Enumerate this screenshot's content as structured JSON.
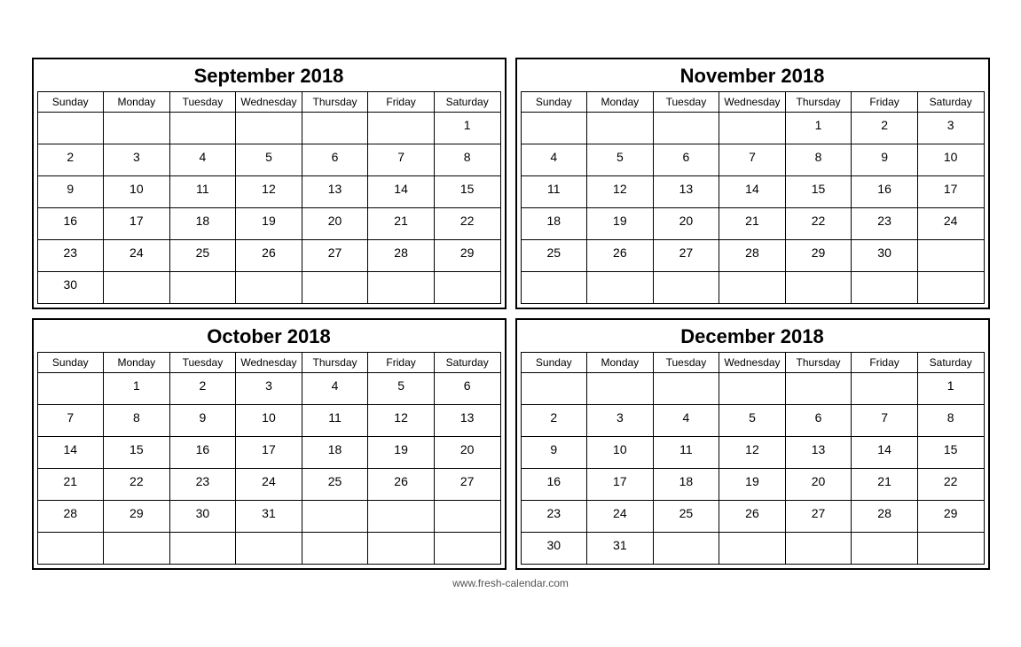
{
  "footer": {
    "url": "www.fresh-calendar.com"
  },
  "calendars": [
    {
      "id": "sep2018",
      "title": "September 2018",
      "days": [
        "Sunday",
        "Monday",
        "Tuesday",
        "Wednesday",
        "Thursday",
        "Friday",
        "Saturday"
      ],
      "weeks": [
        [
          "",
          "",
          "",
          "",
          "",
          "",
          "1"
        ],
        [
          "2",
          "3",
          "4",
          "5",
          "6",
          "7",
          "8"
        ],
        [
          "9",
          "10",
          "11",
          "12",
          "13",
          "14",
          "15"
        ],
        [
          "16",
          "17",
          "18",
          "19",
          "20",
          "21",
          "22"
        ],
        [
          "23",
          "24",
          "25",
          "26",
          "27",
          "28",
          "29"
        ],
        [
          "30",
          "",
          "",
          "",
          "",
          "",
          ""
        ]
      ]
    },
    {
      "id": "nov2018",
      "title": "November 2018",
      "days": [
        "Sunday",
        "Monday",
        "Tuesday",
        "Wednesday",
        "Thursday",
        "Friday",
        "Saturday"
      ],
      "weeks": [
        [
          "",
          "",
          "",
          "",
          "1",
          "2",
          "3"
        ],
        [
          "4",
          "5",
          "6",
          "7",
          "8",
          "9",
          "10"
        ],
        [
          "11",
          "12",
          "13",
          "14",
          "15",
          "16",
          "17"
        ],
        [
          "18",
          "19",
          "20",
          "21",
          "22",
          "23",
          "24"
        ],
        [
          "25",
          "26",
          "27",
          "28",
          "29",
          "30",
          ""
        ],
        [
          "",
          "",
          "",
          "",
          "",
          "",
          ""
        ]
      ]
    },
    {
      "id": "oct2018",
      "title": "October 2018",
      "days": [
        "Sunday",
        "Monday",
        "Tuesday",
        "Wednesday",
        "Thursday",
        "Friday",
        "Saturday"
      ],
      "weeks": [
        [
          "",
          "1",
          "2",
          "3",
          "4",
          "5",
          "6"
        ],
        [
          "7",
          "8",
          "9",
          "10",
          "11",
          "12",
          "13"
        ],
        [
          "14",
          "15",
          "16",
          "17",
          "18",
          "19",
          "20"
        ],
        [
          "21",
          "22",
          "23",
          "24",
          "25",
          "26",
          "27"
        ],
        [
          "28",
          "29",
          "30",
          "31",
          "",
          "",
          ""
        ],
        [
          "",
          "",
          "",
          "",
          "",
          "",
          ""
        ]
      ]
    },
    {
      "id": "dec2018",
      "title": "December 2018",
      "days": [
        "Sunday",
        "Monday",
        "Tuesday",
        "Wednesday",
        "Thursday",
        "Friday",
        "Saturday"
      ],
      "weeks": [
        [
          "",
          "",
          "",
          "",
          "",
          "",
          "1"
        ],
        [
          "2",
          "3",
          "4",
          "5",
          "6",
          "7",
          "8"
        ],
        [
          "9",
          "10",
          "11",
          "12",
          "13",
          "14",
          "15"
        ],
        [
          "16",
          "17",
          "18",
          "19",
          "20",
          "21",
          "22"
        ],
        [
          "23",
          "24",
          "25",
          "26",
          "27",
          "28",
          "29"
        ],
        [
          "30",
          "31",
          "",
          "",
          "",
          "",
          ""
        ]
      ]
    }
  ]
}
